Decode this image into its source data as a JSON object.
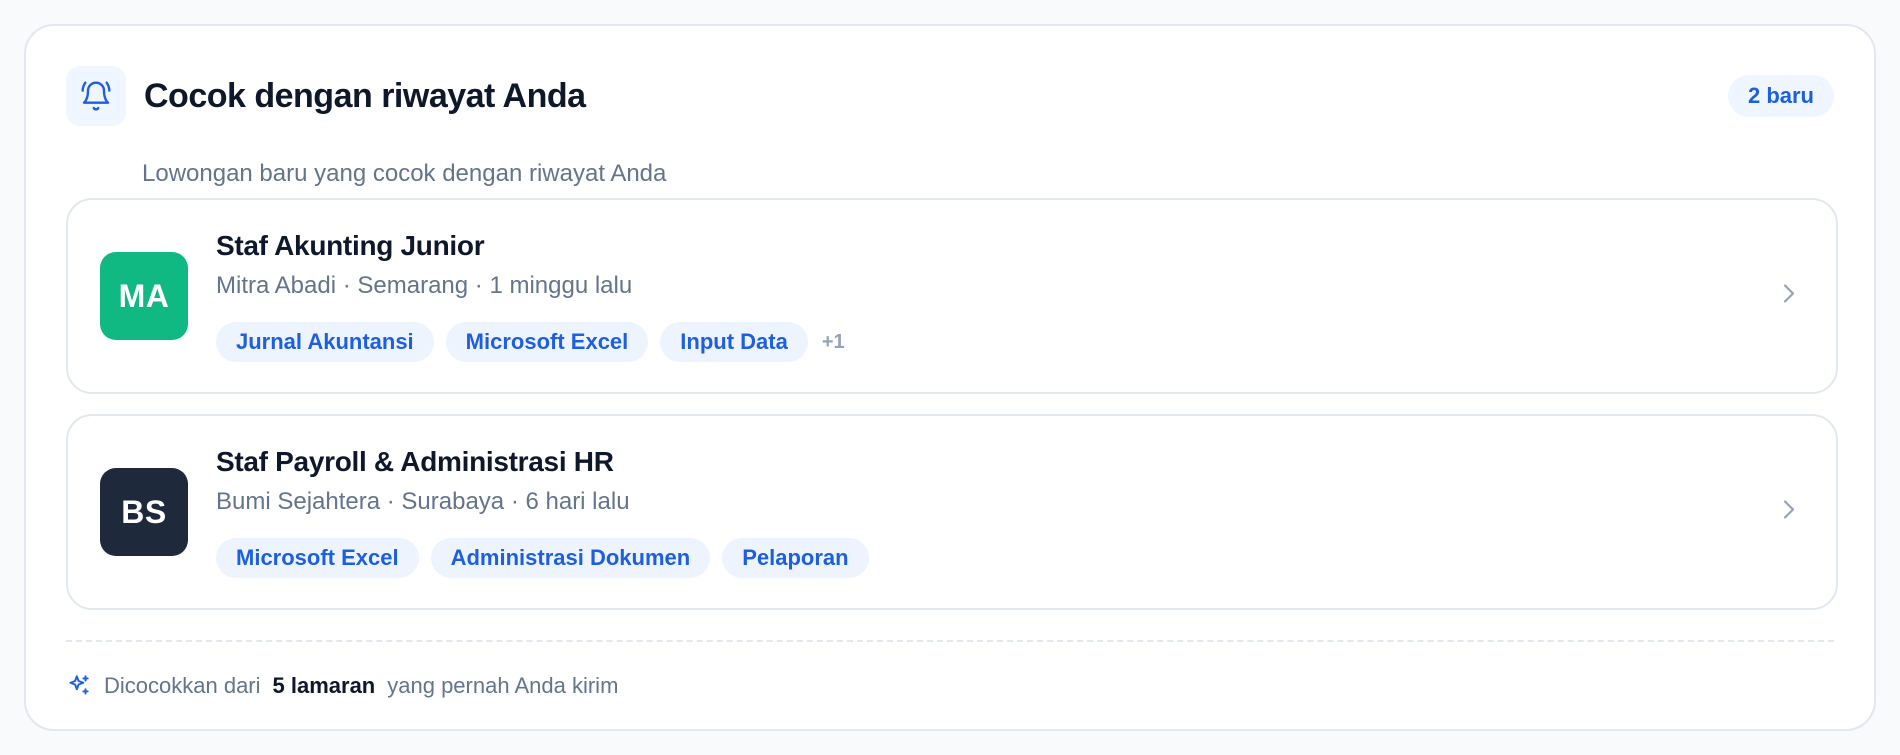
{
  "header": {
    "title": "Cocok dengan riwayat Anda",
    "badge": "2 baru",
    "subtitle": "Lowongan baru yang cocok dengan riwayat Anda",
    "icon": "bell-ring-icon"
  },
  "jobs": [
    {
      "initials": "MA",
      "logo_color": "#10b981",
      "title": "Staf Akunting Junior",
      "meta": "Mitra Abadi · Semarang · 1 minggu lalu",
      "tags": [
        "Jurnal Akuntansi",
        "Microsoft Excel",
        "Input Data"
      ],
      "more": "+1"
    },
    {
      "initials": "BS",
      "logo_color": "#1e293b",
      "title": "Staf Payroll & Administrasi HR",
      "meta": "Bumi Sejahtera · Surabaya · 6 hari lalu",
      "tags": [
        "Microsoft Excel",
        "Administrasi Dokumen",
        "Pelaporan"
      ]
    }
  ],
  "footer": {
    "prefix": "Dicocokkan dari",
    "count": "5 lamaran",
    "suffix": "yang pernah Anda kirim",
    "icon": "sparkles-icon"
  },
  "colors": {
    "accent": "#1d5fe0",
    "accent_bg": "#eff6ff",
    "border": "#e2e8f0",
    "muted_text": "#64748b"
  }
}
